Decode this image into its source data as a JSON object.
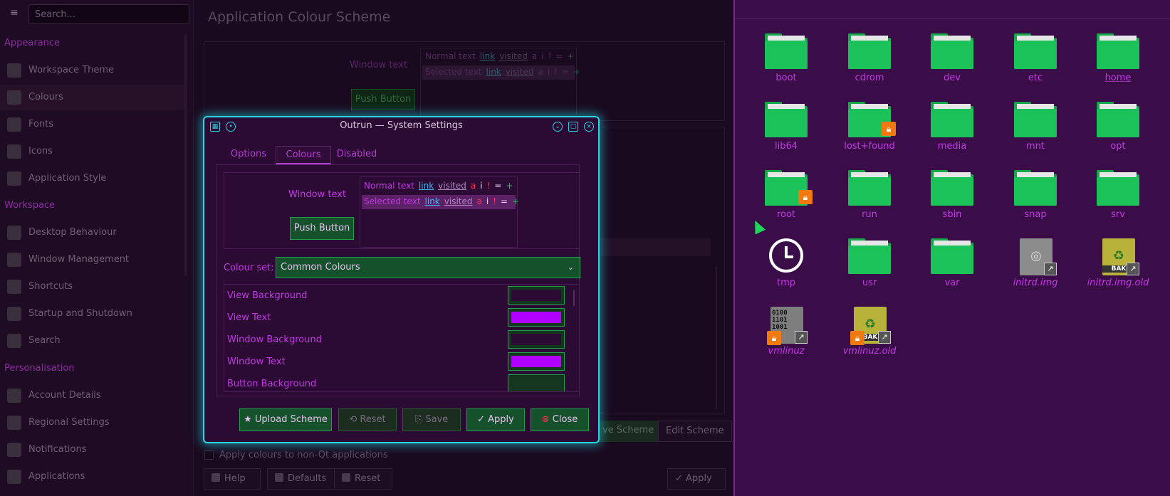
{
  "sidebar": {
    "search_placeholder": "Search...",
    "sections": [
      {
        "title": "Appearance",
        "items": [
          "Workspace Theme",
          "Colours",
          "Fonts",
          "Icons",
          "Application Style"
        ]
      },
      {
        "title": "Workspace",
        "items": [
          "Desktop Behaviour",
          "Window Management",
          "Shortcuts",
          "Startup and Shutdown",
          "Search"
        ]
      },
      {
        "title": "Personalisation",
        "items": [
          "Account Details",
          "Regional Settings",
          "Notifications",
          "Applications"
        ]
      }
    ],
    "active_item": "Colours"
  },
  "main": {
    "title": "Application Colour Scheme",
    "preview": {
      "window_text": "Window text",
      "push_button": "Push Button",
      "normal_text": "Normal text",
      "selected_text": "Selected text",
      "link": "link",
      "visited": "visited",
      "symbols": [
        "a",
        "i",
        "!",
        "=",
        "+"
      ]
    },
    "buttons": {
      "save_scheme": "ve Scheme",
      "edit_scheme": "Edit Scheme",
      "help": "Help",
      "defaults": "Defaults",
      "reset": "Reset",
      "apply": "Apply"
    },
    "checkbox_label": "Apply colours to non-Qt applications"
  },
  "dialog": {
    "title": "Outrun — System Settings",
    "tabs": [
      "Options",
      "Colours",
      "Disabled"
    ],
    "active_tab": "Colours",
    "preview": {
      "window_text": "Window text",
      "push_button": "Push Button",
      "normal_text": "Normal text",
      "selected_text": "Selected text",
      "link": "link",
      "visited": "visited",
      "symbols": [
        "a",
        "i",
        "!",
        "=",
        "+"
      ]
    },
    "colour_set_label": "Colour set:",
    "colour_set_value": "Common Colours",
    "colour_rows": [
      {
        "label": "View Background",
        "swatch": "#2b0a33"
      },
      {
        "label": "View Text",
        "swatch": "#b100ff"
      },
      {
        "label": "Window Background",
        "swatch": "#2b0a33"
      },
      {
        "label": "Window Text",
        "swatch": "#b100ff"
      },
      {
        "label": "Button Background",
        "swatch": "#15361f"
      }
    ],
    "buttons": {
      "upload": "Upload Scheme",
      "reset": "Reset",
      "save": "Save",
      "apply": "Apply",
      "close": "Close"
    }
  },
  "file_manager": {
    "items": [
      {
        "name": "boot",
        "icon": "folder"
      },
      {
        "name": "cdrom",
        "icon": "folder"
      },
      {
        "name": "dev",
        "icon": "folder"
      },
      {
        "name": "etc",
        "icon": "folder"
      },
      {
        "name": "home",
        "icon": "folder"
      },
      {
        "name": "lib64",
        "icon": "folder"
      },
      {
        "name": "lost+found",
        "icon": "folder-locked"
      },
      {
        "name": "media",
        "icon": "folder"
      },
      {
        "name": "mnt",
        "icon": "folder"
      },
      {
        "name": "opt",
        "icon": "folder"
      },
      {
        "name": "root",
        "icon": "folder-locked"
      },
      {
        "name": "run",
        "icon": "folder"
      },
      {
        "name": "sbin",
        "icon": "folder"
      },
      {
        "name": "snap",
        "icon": "folder"
      },
      {
        "name": "srv",
        "icon": "folder"
      },
      {
        "name": "tmp",
        "icon": "clock"
      },
      {
        "name": "usr",
        "icon": "folder"
      },
      {
        "name": "var",
        "icon": "folder"
      },
      {
        "name": "initrd.img",
        "icon": "disc-image-link"
      },
      {
        "name": "initrd.img.old",
        "icon": "backup-file-link"
      },
      {
        "name": "vmlinuz",
        "icon": "binary-file-locked-link"
      },
      {
        "name": "vmlinuz.old",
        "icon": "backup-file-locked-link"
      }
    ],
    "colors": {
      "folder": "#1bc25a",
      "label": "#c436e8",
      "lock": "#f07a10"
    }
  }
}
